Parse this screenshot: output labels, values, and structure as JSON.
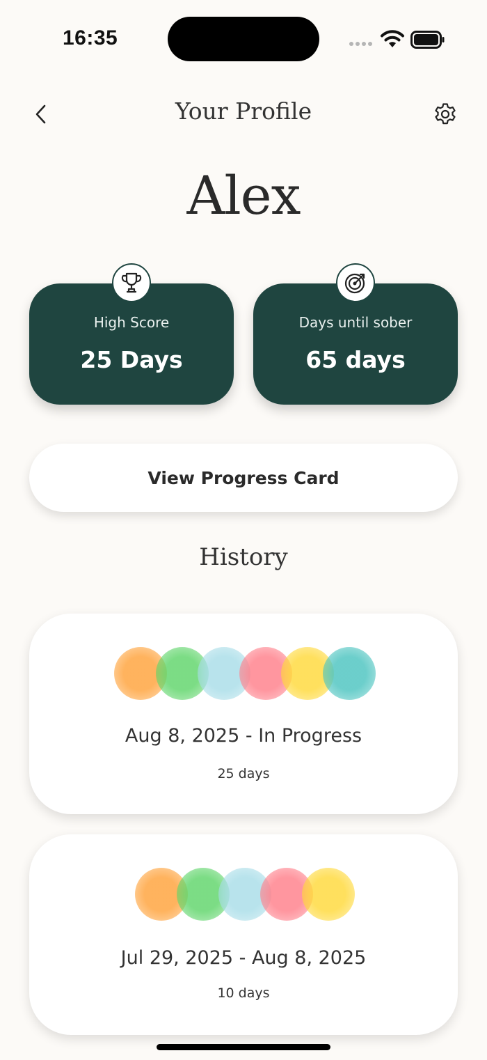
{
  "status_bar": {
    "time": "16:35"
  },
  "header": {
    "title": "Your Profile"
  },
  "user": {
    "name": "Alex"
  },
  "stats": [
    {
      "label": "High Score",
      "value": "25 Days",
      "icon": "trophy-icon"
    },
    {
      "label": "Days until sober",
      "value": "65 days",
      "icon": "target-icon"
    }
  ],
  "progress_button": {
    "label": "View Progress Card"
  },
  "history": {
    "title": "History",
    "entries": [
      {
        "range": "Aug 8, 2025 - In Progress",
        "length": "25 days",
        "colors": [
          "#ffa23a",
          "#5fd56a",
          "#a8dde8",
          "#ff7f8a",
          "#ffd93a",
          "#4cc4c0"
        ]
      },
      {
        "range": "Jul 29, 2025 - Aug 8, 2025",
        "length": "10 days",
        "colors": [
          "#ffa23a",
          "#5fd56a",
          "#a8dde8",
          "#ff7f8a",
          "#ffd93a"
        ]
      }
    ]
  },
  "colors": {
    "card": "#1f4540",
    "background": "#fcfaf7"
  }
}
